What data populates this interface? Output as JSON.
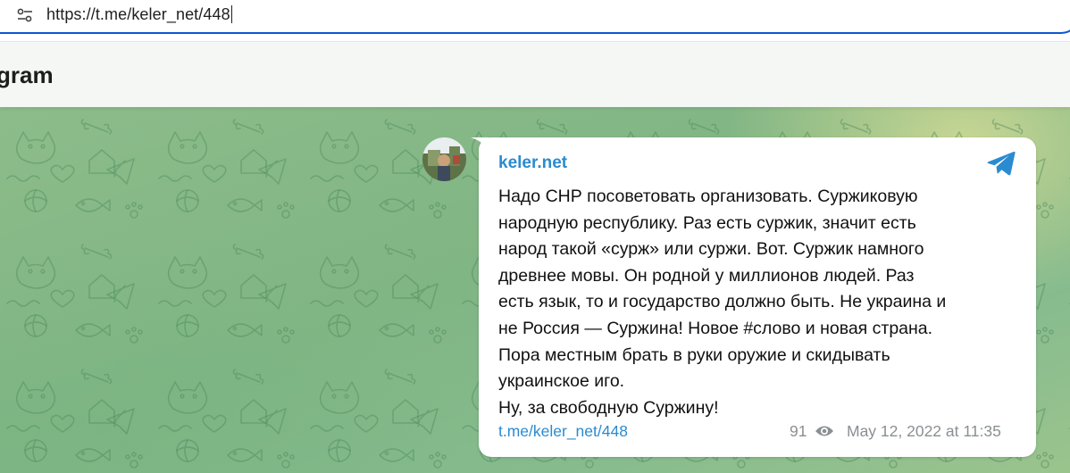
{
  "browser": {
    "url": "https://t.me/keler_net/448",
    "site_info_icon": "tune-icon"
  },
  "header": {
    "title": "gram"
  },
  "post": {
    "channel_name": "keler.net",
    "avatar_icon": "channel-avatar",
    "logo_icon": "telegram-logo-icon",
    "text_lines": [
      "Надо СНР посоветовать организовать. Суржиковую",
      "народную республику. Раз есть суржик, значит есть",
      "народ такой «сурж» или суржи. Вот. Суржик намного",
      "древнее мовы. Он родной у миллионов людей. Раз",
      "есть язык, то и государство должно быть. Не украина и",
      "не Россия — Суржина! Новое #слово и новая страна.",
      "Пора местным брать в руки оружие и скидывать",
      "украинское иго.",
      "Ну, за свободную Суржину!"
    ],
    "link": "t.me/keler_net/448",
    "views": "91",
    "views_icon": "eye-icon",
    "date": "May 12, 2022 at 11:35"
  },
  "colors": {
    "accent": "#2a8bd1",
    "address_border": "#0b57d0",
    "background_green": "#86bb8e",
    "meta_gray": "#8a8f93"
  }
}
